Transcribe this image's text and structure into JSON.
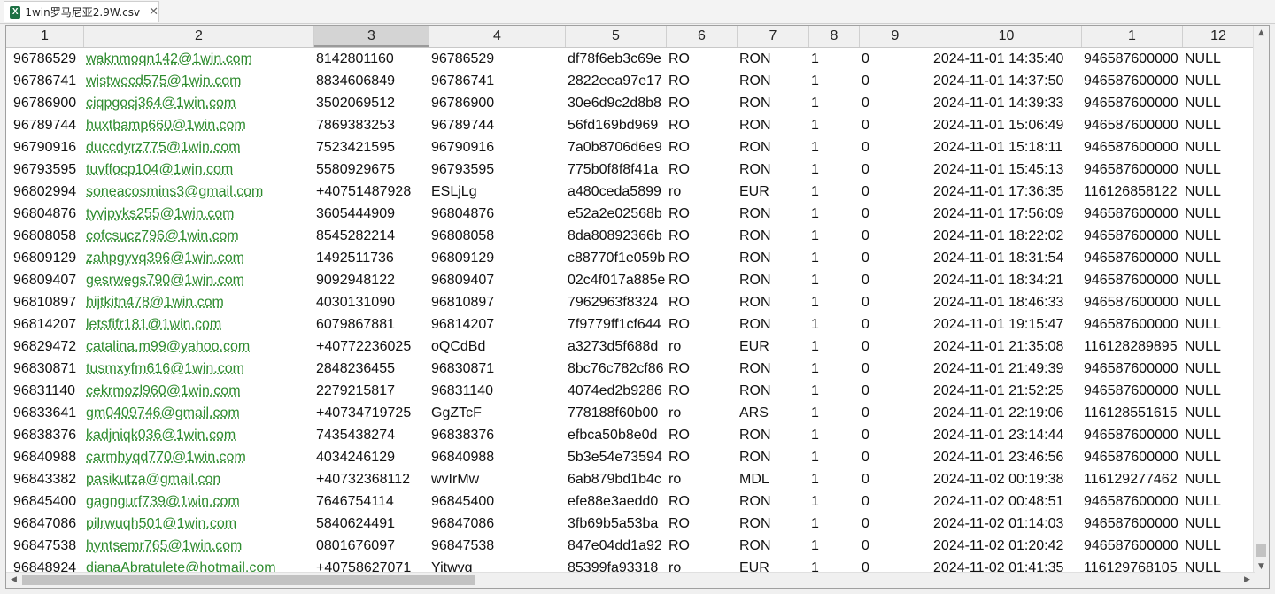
{
  "tab": {
    "title": "1win罗马尼亚2.9W.csv",
    "close": "✕"
  },
  "headers": [
    "1",
    "2",
    "3",
    "4",
    "5",
    "6",
    "7",
    "8",
    "9",
    "10",
    "1",
    "12"
  ],
  "rows": [
    [
      "96786529",
      "waknmoqn142@1win.com",
      "8142801160",
      "96786529",
      "df78f6eb3c69e",
      "RO",
      "RON",
      "1",
      "0",
      "2024-11-01 14:35:40",
      "946587600000",
      "NULL"
    ],
    [
      "96786741",
      "wistwecd575@1win.com",
      "8834606849",
      "96786741",
      "2822eea97e17",
      "RO",
      "RON",
      "1",
      "0",
      "2024-11-01 14:37:50",
      "946587600000",
      "NULL"
    ],
    [
      "96786900",
      "ciqpgocj364@1win.com",
      "3502069512",
      "96786900",
      "30e6d9c2d8b8",
      "RO",
      "RON",
      "1",
      "0",
      "2024-11-01 14:39:33",
      "946587600000",
      "NULL"
    ],
    [
      "96789744",
      "huxtbamp660@1win.com",
      "7869383253",
      "96789744",
      "56fd169bd969",
      "RO",
      "RON",
      "1",
      "0",
      "2024-11-01 15:06:49",
      "946587600000",
      "NULL"
    ],
    [
      "96790916",
      "duccdyrz775@1win.com",
      "7523421595",
      "96790916",
      "7a0b8706d6e9",
      "RO",
      "RON",
      "1",
      "0",
      "2024-11-01 15:18:11",
      "946587600000",
      "NULL"
    ],
    [
      "96793595",
      "tuvffocp104@1win.com",
      "5580929675",
      "96793595",
      "775b0f8f8f41a",
      "RO",
      "RON",
      "1",
      "0",
      "2024-11-01 15:45:13",
      "946587600000",
      "NULL"
    ],
    [
      "96802994",
      "soneacosmins3@gmail.com",
      "+40751487928",
      "ESLjLg",
      "a480ceda5899",
      "ro",
      "EUR",
      "1",
      "0",
      "2024-11-01 17:36:35",
      "116126858122",
      "NULL"
    ],
    [
      "96804876",
      "tyvjpyks255@1win.com",
      "3605444909",
      "96804876",
      "e52a2e02568b",
      "RO",
      "RON",
      "1",
      "0",
      "2024-11-01 17:56:09",
      "946587600000",
      "NULL"
    ],
    [
      "96808058",
      "cofcsucz796@1win.com",
      "8545282214",
      "96808058",
      "8da80892366b",
      "RO",
      "RON",
      "1",
      "0",
      "2024-11-01 18:22:02",
      "946587600000",
      "NULL"
    ],
    [
      "96809129",
      "zahpgyvq396@1win.com",
      "1492511736",
      "96809129",
      "c88770f1e059b",
      "RO",
      "RON",
      "1",
      "0",
      "2024-11-01 18:31:54",
      "946587600000",
      "NULL"
    ],
    [
      "96809407",
      "gesrwegs790@1win.com",
      "9092948122",
      "96809407",
      "02c4f017a885e",
      "RO",
      "RON",
      "1",
      "0",
      "2024-11-01 18:34:21",
      "946587600000",
      "NULL"
    ],
    [
      "96810897",
      "hijtkitn478@1win.com",
      "4030131090",
      "96810897",
      "7962963f8324",
      "RO",
      "RON",
      "1",
      "0",
      "2024-11-01 18:46:33",
      "946587600000",
      "NULL"
    ],
    [
      "96814207",
      "letsfifr181@1win.com",
      "6079867881",
      "96814207",
      "7f9779ff1cf644",
      "RO",
      "RON",
      "1",
      "0",
      "2024-11-01 19:15:47",
      "946587600000",
      "NULL"
    ],
    [
      "96829472",
      "catalina.m99@yahoo.com",
      "+40772236025",
      "oQCdBd",
      "a3273d5f688d",
      "ro",
      "EUR",
      "1",
      "0",
      "2024-11-01 21:35:08",
      "116128289895",
      "NULL"
    ],
    [
      "96830871",
      "tusmxyfm616@1win.com",
      "2848236455",
      "96830871",
      "8bc76c782cf86",
      "RO",
      "RON",
      "1",
      "0",
      "2024-11-01 21:49:39",
      "946587600000",
      "NULL"
    ],
    [
      "96831140",
      "cekrmozl960@1win.com",
      "2279215817",
      "96831140",
      "4074ed2b9286",
      "RO",
      "RON",
      "1",
      "0",
      "2024-11-01 21:52:25",
      "946587600000",
      "NULL"
    ],
    [
      "96833641",
      "gm0409746@gmail.com",
      "+40734719725",
      "GgZTcF",
      "778188f60b00",
      "ro",
      "ARS",
      "1",
      "0",
      "2024-11-01 22:19:06",
      "116128551615",
      "NULL"
    ],
    [
      "96838376",
      "kadjniqk036@1win.com",
      "7435438274",
      "96838376",
      "efbca50b8e0d",
      "RO",
      "RON",
      "1",
      "0",
      "2024-11-01 23:14:44",
      "946587600000",
      "NULL"
    ],
    [
      "96840988",
      "carmhyqd770@1win.com",
      "4034246129",
      "96840988",
      "5b3e54e73594",
      "RO",
      "RON",
      "1",
      "0",
      "2024-11-01 23:46:56",
      "946587600000",
      "NULL"
    ],
    [
      "96843382",
      "pasikutza@gmail.con",
      "+40732368112",
      "wvIrMw",
      "6ab879bd1b4c",
      "ro",
      "MDL",
      "1",
      "0",
      "2024-11-02 00:19:38",
      "116129277462",
      "NULL"
    ],
    [
      "96845400",
      "gagngurf739@1win.com",
      "7646754114",
      "96845400",
      "efe88e3aedd0",
      "RO",
      "RON",
      "1",
      "0",
      "2024-11-02 00:48:51",
      "946587600000",
      "NULL"
    ],
    [
      "96847086",
      "pilrwuqh501@1win.com",
      "5840624491",
      "96847086",
      "3fb69b5a53ba",
      "RO",
      "RON",
      "1",
      "0",
      "2024-11-02 01:14:03",
      "946587600000",
      "NULL"
    ],
    [
      "96847538",
      "hyntsemr765@1win.com",
      "0801676097",
      "96847538",
      "847e04dd1a92",
      "RO",
      "RON",
      "1",
      "0",
      "2024-11-02 01:20:42",
      "946587600000",
      "NULL"
    ],
    [
      "96848924",
      "dianaAbratulete@hotmail.com",
      "+40758627071",
      "Yitwvg",
      "85399fa93318",
      "ro",
      "EUR",
      "1",
      "0",
      "2024-11-02 01:41:35",
      "116129768105",
      "NULL"
    ]
  ],
  "icons": {
    "excel": "excel-file-icon"
  }
}
